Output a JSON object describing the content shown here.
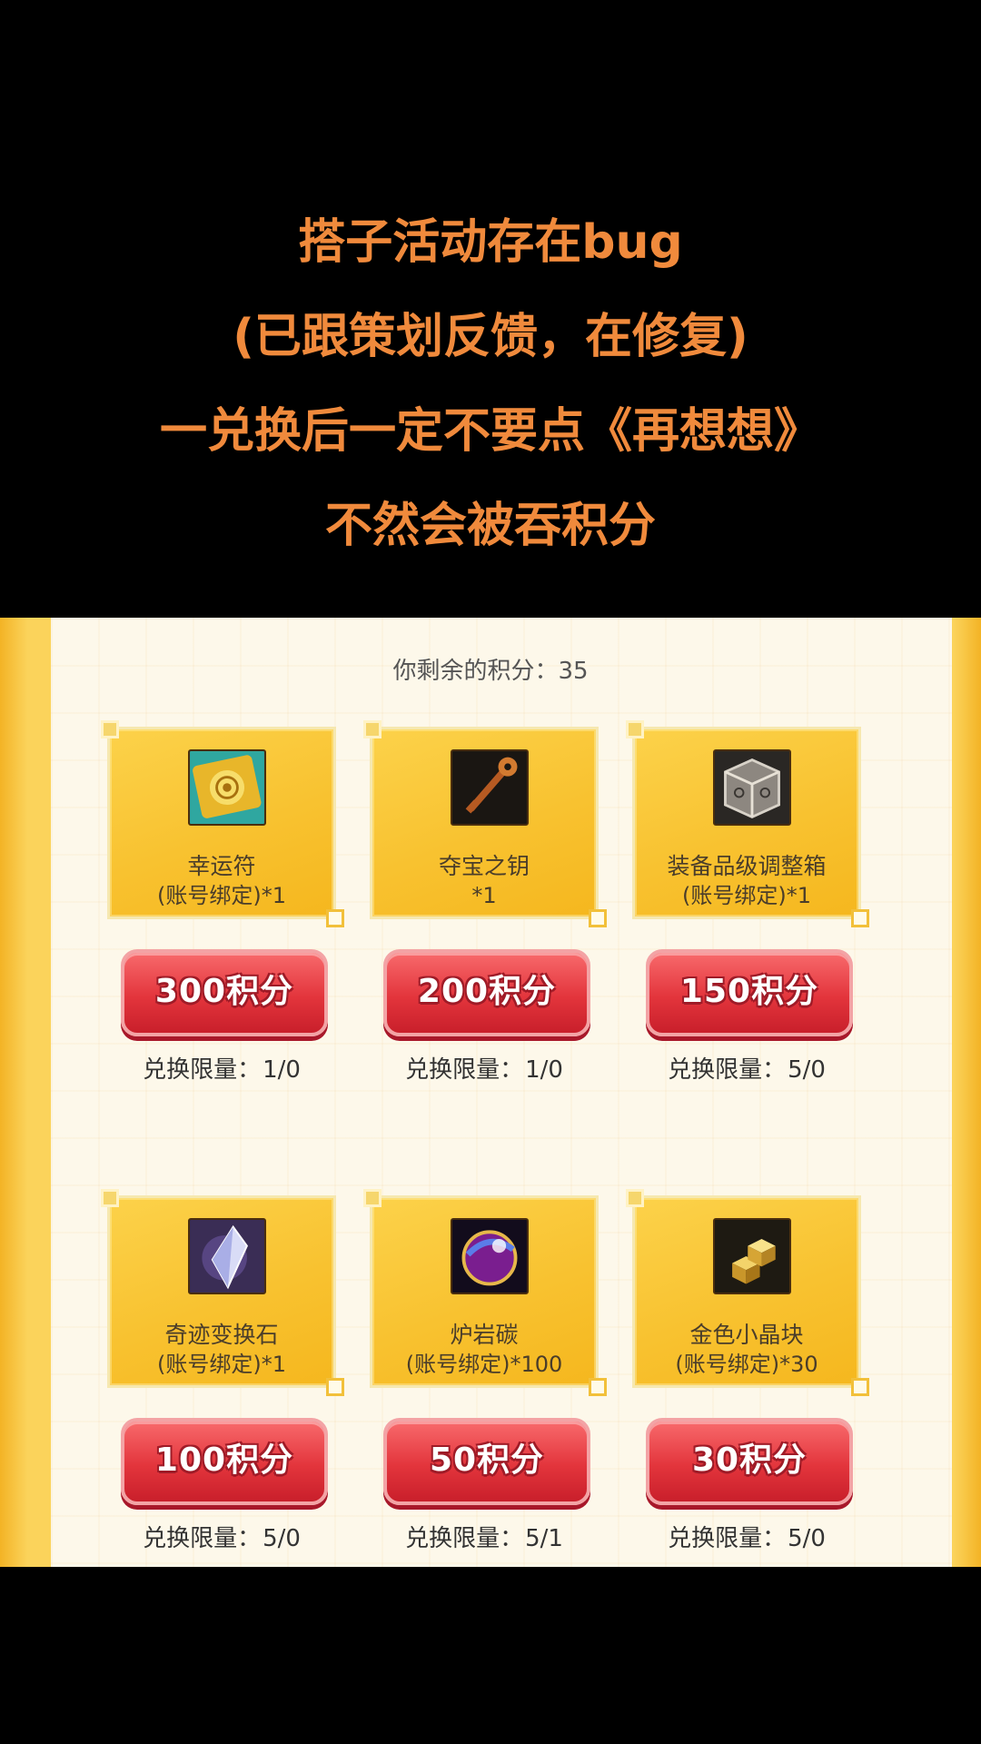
{
  "caption": {
    "lines": [
      "搭子活动存在bug",
      "(已跟策划反馈，在修复)",
      "一兑换后一定不要点《再想想》",
      "不然会被吞积分"
    ]
  },
  "panel": {
    "points_label": "你剩余的积分：",
    "points_value": "35",
    "limit_label": "兑换限量：",
    "colors": {
      "card": "#f8c230",
      "button": "#e3353c",
      "caption": "#f08a3c"
    }
  },
  "items": [
    {
      "name": "幸运符",
      "qty": "(账号绑定)*1",
      "price": "300积分",
      "limit": "1/0",
      "icon": "lucky-charm-icon"
    },
    {
      "name": "夺宝之钥",
      "qty": "*1",
      "price": "200积分",
      "limit": "1/0",
      "icon": "treasure-key-icon"
    },
    {
      "name": "装备品级调整箱",
      "qty": "(账号绑定)*1",
      "price": "150积分",
      "limit": "5/0",
      "icon": "grade-box-icon"
    },
    {
      "name": "奇迹变换石",
      "qty": "(账号绑定)*1",
      "price": "100积分",
      "limit": "5/0",
      "icon": "miracle-stone-icon"
    },
    {
      "name": "炉岩碳",
      "qty": "(账号绑定)*100",
      "price": "50积分",
      "limit": "5/1",
      "icon": "furnace-carbon-icon"
    },
    {
      "name": "金色小晶块",
      "qty": "(账号绑定)*30",
      "price": "30积分",
      "limit": "5/0",
      "icon": "gold-crystal-icon"
    }
  ]
}
